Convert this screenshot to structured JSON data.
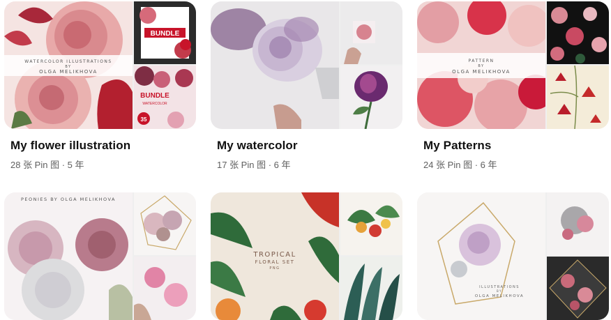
{
  "boards": [
    {
      "title": "My flower illustration",
      "meta": "28 张 Pin 图 · 5 年",
      "cover": {
        "main_line1": "WATERCOLOR ILLUSTRATIONS",
        "main_line2": "BY",
        "main_line3": "OLGA MELIKHOVA",
        "top_badge": "BUNDLE",
        "bottom_badge1": "BUNDLE",
        "bottom_badge2": "WATERCOLOR",
        "bottom_price": "35"
      }
    },
    {
      "title": "My watercolor",
      "meta": "17 张 Pin 图 · 6 年",
      "cover": {}
    },
    {
      "title": "My Patterns",
      "meta": "24 张 Pin 图 · 6 年",
      "cover": {
        "main_line1": "PATTERN",
        "main_line2": "BY",
        "main_line3": "OLGA MELIKHOVA"
      }
    },
    {
      "title": "",
      "meta": "",
      "cover": {
        "main_line1": "PEONIES BY OLGA MELIKHOVA"
      }
    },
    {
      "title": "",
      "meta": "",
      "cover": {
        "main_line1": "TROPICAL",
        "main_line2": "FLORAL SET",
        "main_line3": "PNG"
      }
    },
    {
      "title": "",
      "meta": "",
      "cover": {
        "main_line1": "ILLUSTRATIONS",
        "main_line2": "BY",
        "main_line3": "OLGA MELIKHOVA"
      }
    }
  ],
  "colors": {
    "title": "#111111",
    "meta": "#5f5f5f",
    "cover_bg": "#efefef"
  }
}
